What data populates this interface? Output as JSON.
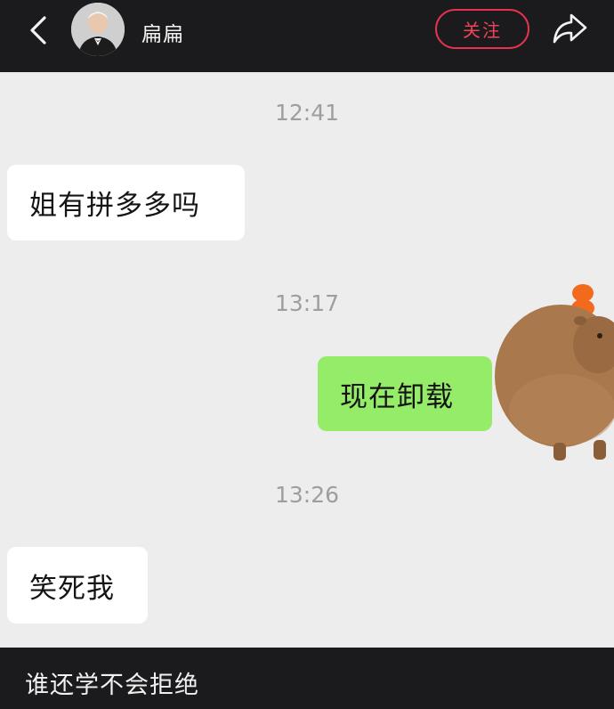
{
  "header": {
    "contact_name": "扁扁",
    "follow_label": "关注"
  },
  "messages": [
    {
      "timestamp": "12:41",
      "text": "姐有拼多多吗",
      "sender": "other"
    },
    {
      "timestamp": "13:17",
      "text": "现在卸载",
      "sender": "self"
    },
    {
      "timestamp": "13:26",
      "text": "笑死我",
      "sender": "other"
    }
  ],
  "caption": "谁还学不会拒绝",
  "colors": {
    "topbar": "#1b1b1d",
    "chat_background": "#ededed",
    "incoming_bubble": "#ffffff",
    "outgoing_bubble": "#95ec69",
    "follow_accent": "#e5334f"
  },
  "icons": {
    "back": "chevron-left-icon",
    "share": "share-arrow-icon",
    "sticker": "capybara-with-oranges-sticker"
  }
}
